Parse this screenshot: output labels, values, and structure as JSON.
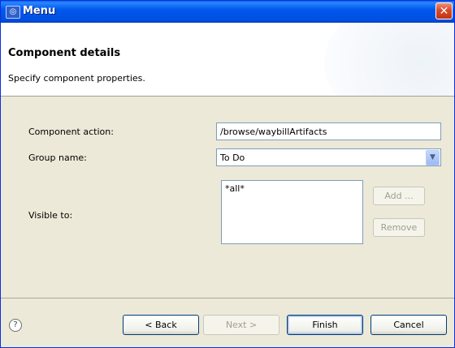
{
  "window": {
    "title": "Menu",
    "icon": "hp-app-icon",
    "close_icon": "close-icon"
  },
  "header": {
    "title": "Component details",
    "description": "Specify component properties."
  },
  "form": {
    "component_action": {
      "label": "Component action:",
      "value": "/browse/waybillArtifacts"
    },
    "group_name": {
      "label": "Group name:",
      "value": "To Do"
    },
    "visible_to": {
      "label": "Visible to:",
      "items": [
        "*all*"
      ]
    },
    "add_label": "Add ...",
    "remove_label": "Remove"
  },
  "footer": {
    "help_icon": "help-icon",
    "back_label": "< Back",
    "next_label": "Next >",
    "finish_label": "Finish",
    "cancel_label": "Cancel"
  }
}
